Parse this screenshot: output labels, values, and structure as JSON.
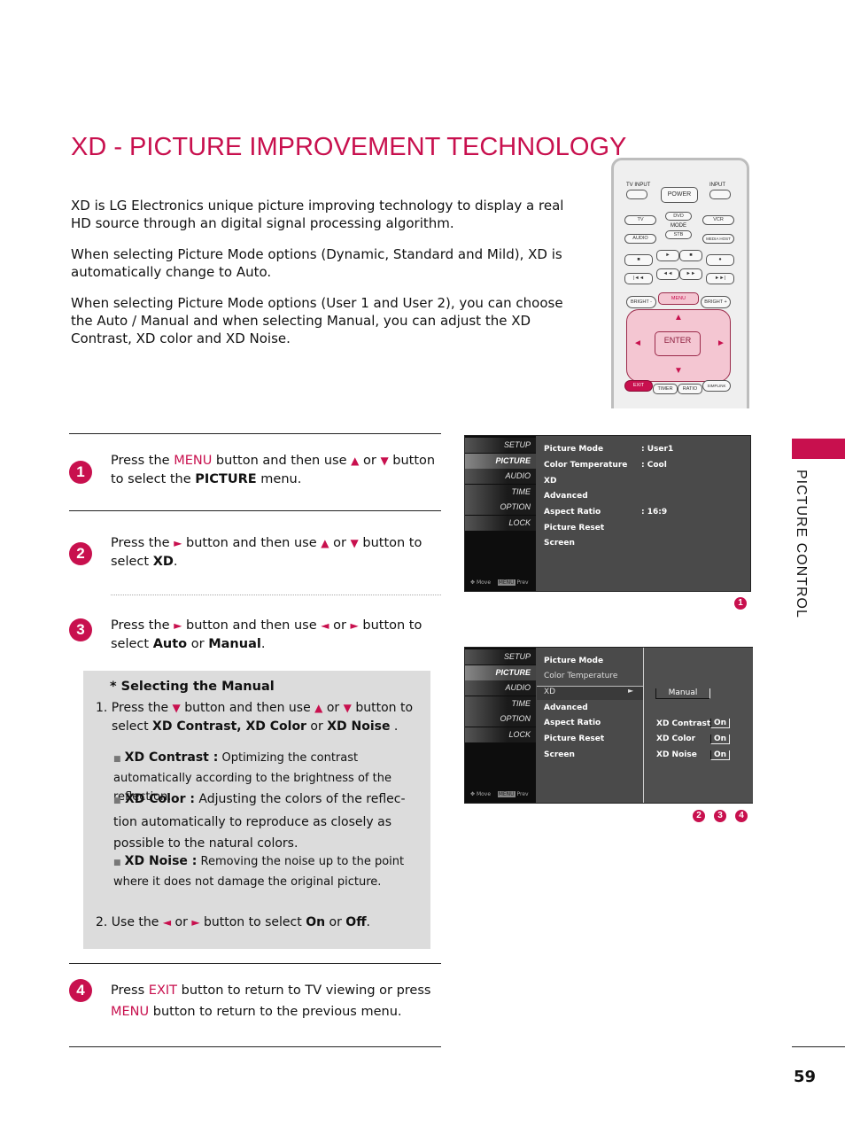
{
  "page": {
    "title": "XD - PICTURE IMPROVEMENT TECHNOLOGY",
    "intro": [
      "XD is LG Electronics unique picture improving technology to display a real HD source through an  digital signal processing algorithm.",
      "When selecting Picture Mode options (Dynamic, Standard and Mild), XD is automatically change to Auto.",
      "When selecting Picture Mode options (User 1 and User 2), you can choose the Auto / Manual and when selecting Manual, you can adjust the XD Contrast, XD color and XD Noise."
    ],
    "section_tab": "PICTURE CONTROL",
    "page_number": "59",
    "accent_color": "#c8104e"
  },
  "steps": [
    {
      "num": "1",
      "parts": [
        "Press the ",
        "MENU",
        " button and then use ",
        "▲",
        " or ",
        "▼",
        " button to select the ",
        "PICTURE",
        " menu."
      ]
    },
    {
      "num": "2",
      "parts": [
        "Press the ",
        "►",
        " button and then use ",
        "▲",
        " or ",
        "▼",
        " button to select  ",
        "XD",
        "."
      ]
    },
    {
      "num": "3",
      "parts": [
        "Press the ",
        "►",
        " button and then use ",
        "◄",
        " or ",
        "►",
        " button to select  ",
        "Auto",
        " or ",
        "Manual",
        "."
      ]
    },
    {
      "num": "4",
      "parts": [
        "Press ",
        "EXIT",
        " button to return to TV viewing or press ",
        "MENU",
        " button to return to the previous menu."
      ]
    }
  ],
  "manual": {
    "title": "* Selecting the Manual",
    "item1": {
      "prefix": "1. Press the ",
      "down": "▼",
      "mid": " button and then use  ",
      "up": "▲",
      "or": " or ",
      "down2": "▼",
      "end": " button to",
      "line2a": "select ",
      "b1": "XD Contrast, XD Color",
      "or2": " or ",
      "b2": "XD Noise",
      "dot": " ."
    },
    "bullets": [
      {
        "label": "XD Contrast :",
        "text": " Optimizing the contrast  automatically according to the brightness of the  reflection."
      },
      {
        "label": "XD Color :",
        "text": " Adjusting the colors of the reflec-tion automatically to reproduce as closely as possible to the natural colors."
      },
      {
        "label": "XD Noise :",
        "text": " Removing the noise up to the point where it does not damage the original picture."
      }
    ],
    "item2": {
      "prefix": "2. Use the ",
      "left": "◄",
      "or": " or ",
      "right": "►",
      "mid": " button to select ",
      "on": "On",
      "or2": " or ",
      "off": "Off",
      "dot": "."
    }
  },
  "osd_tabs": [
    "SETUP",
    "PICTURE",
    "AUDIO",
    "TIME",
    "OPTION",
    "LOCK"
  ],
  "osd_footer": {
    "move": "Move",
    "menu": "MENU",
    "prev": "Prev"
  },
  "osd1": {
    "items": [
      {
        "label": "Picture Mode",
        "value": ": User1"
      },
      {
        "label": "Color Temperature",
        "value": ": Cool"
      },
      {
        "label": "XD",
        "value": ""
      },
      {
        "label": "Advanced",
        "value": ""
      },
      {
        "label": "Aspect Ratio",
        "value": ": 16:9"
      },
      {
        "label": "Picture Reset",
        "value": ""
      },
      {
        "label": "Screen",
        "value": ""
      }
    ],
    "callouts": [
      "1"
    ]
  },
  "osd2": {
    "items": [
      "Picture Mode",
      "Color Temperature",
      "XD",
      "Advanced",
      "Aspect Ratio",
      "Picture Reset",
      "Screen"
    ],
    "selected_arrow": "►",
    "mode_value": "Manual",
    "settings": [
      {
        "label": "XD Contrast",
        "value": "On"
      },
      {
        "label": "XD Color",
        "value": "On"
      },
      {
        "label": "XD Noise",
        "value": "On"
      }
    ],
    "callouts": [
      "2",
      "3",
      "4"
    ]
  },
  "remote": {
    "tv_input": "TV INPUT",
    "power": "POWER",
    "input": "INPUT",
    "tv": "TV",
    "dvd": "DVD",
    "vcr": "VCR",
    "mode": "MODE",
    "audio": "AUDIO",
    "stb": "STB",
    "media_host": "MEDIA HOST",
    "stop": "■",
    "play": "►",
    "pause": "■",
    "rec": "●",
    "prev": "|◄◄",
    "rew": "◄◄",
    "ff": "►►",
    "next": "►►|",
    "bright_minus": "BRIGHT -",
    "menu": "MENU",
    "bright_plus": "BRIGHT +",
    "enter": "ENTER",
    "up": "▲",
    "down": "▼",
    "left": "◄",
    "right": "►",
    "exit": "EXIT",
    "timer": "TIMER",
    "ratio": "RATIO",
    "simplink": "SIMPLINK"
  }
}
